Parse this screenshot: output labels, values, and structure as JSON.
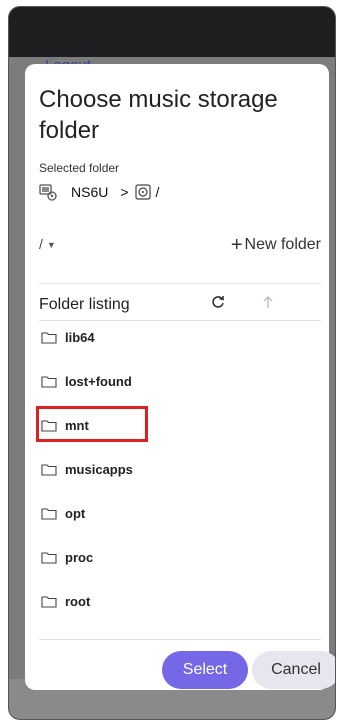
{
  "background": {
    "back_label": "Logout"
  },
  "dialog": {
    "title": "Choose music storage folder",
    "selected_folder_label": "Selected folder",
    "device_name": "NS6U",
    "separator": ">",
    "selected_path": "/"
  },
  "path_bar": {
    "current": "/",
    "new_folder_label": "New folder"
  },
  "listing": {
    "title": "Folder listing",
    "items": [
      {
        "name": "lib64"
      },
      {
        "name": "lost+found"
      },
      {
        "name": "mnt",
        "highlighted": true
      },
      {
        "name": "musicapps"
      },
      {
        "name": "opt"
      },
      {
        "name": "proc"
      },
      {
        "name": "root"
      }
    ]
  },
  "buttons": {
    "select_label": "Select",
    "cancel_label": "Cancel"
  },
  "colors": {
    "accent": "#7468e6",
    "highlight_box": "#e02020",
    "cancel_bg": "#e6e6ef"
  }
}
